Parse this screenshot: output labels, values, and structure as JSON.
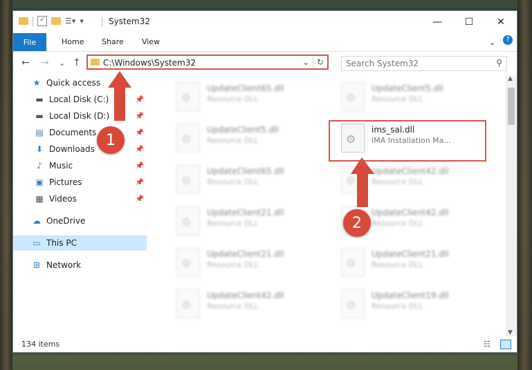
{
  "window": {
    "title": "System32",
    "minimize": "—",
    "maximize": "☐",
    "close": "✕"
  },
  "ribbon": {
    "file": "File",
    "home": "Home",
    "share": "Share",
    "view": "View",
    "help": "?"
  },
  "nav": {
    "back": "←",
    "forward": "→",
    "recent": "⌄",
    "up": "↑",
    "address": "C:\\Windows\\System32",
    "search_placeholder": "Search System32"
  },
  "sidebar": {
    "items": [
      {
        "label": "Quick access",
        "icon": "star-icon"
      },
      {
        "label": "Local Disk (C:)",
        "icon": "drive-icon"
      },
      {
        "label": "Local Disk (D:)",
        "icon": "drive-icon"
      },
      {
        "label": "Documents",
        "icon": "documents-icon"
      },
      {
        "label": "Downloads",
        "icon": "downloads-icon"
      },
      {
        "label": "Music",
        "icon": "music-icon"
      },
      {
        "label": "Pictures",
        "icon": "pictures-icon"
      },
      {
        "label": "Videos",
        "icon": "videos-icon"
      },
      {
        "label": "OneDrive",
        "icon": "cloud-icon"
      },
      {
        "label": "This PC",
        "icon": "pc-icon"
      },
      {
        "label": "Network",
        "icon": "network-icon"
      }
    ]
  },
  "files": [
    {
      "name": "UpdateClient65.dll",
      "type": "Resource DLL"
    },
    {
      "name": "UpdateClient5.dll",
      "type": "Resource DLL"
    },
    {
      "name": "UpdateClient5.dll",
      "type": "Resource DLL"
    },
    {
      "name": "ims_sal.dll",
      "type": "IMA Installation Ma..."
    },
    {
      "name": "UpdateClient65.dll",
      "type": "Resource DLL"
    },
    {
      "name": "UpdateClient42.dll",
      "type": "Resource DLL"
    },
    {
      "name": "UpdateClient21.dll",
      "type": "Resource DLL"
    },
    {
      "name": "UpdateClient42.dll",
      "type": "Resource DLL"
    },
    {
      "name": "UpdateClient21.dll",
      "type": "Resource DLL"
    },
    {
      "name": "UpdateClient21.dll",
      "type": "Resource DLL"
    },
    {
      "name": "UpdateClient42.dll",
      "type": "Resource DLL"
    },
    {
      "name": "UpdateClient19.dll",
      "type": "Resource DLL"
    }
  ],
  "status": {
    "count": "134 items"
  },
  "annotations": {
    "step1": "1",
    "step2": "2"
  },
  "colors": {
    "accent": "#1979ca",
    "highlight": "#d9534f",
    "badge": "#d74a3a"
  }
}
